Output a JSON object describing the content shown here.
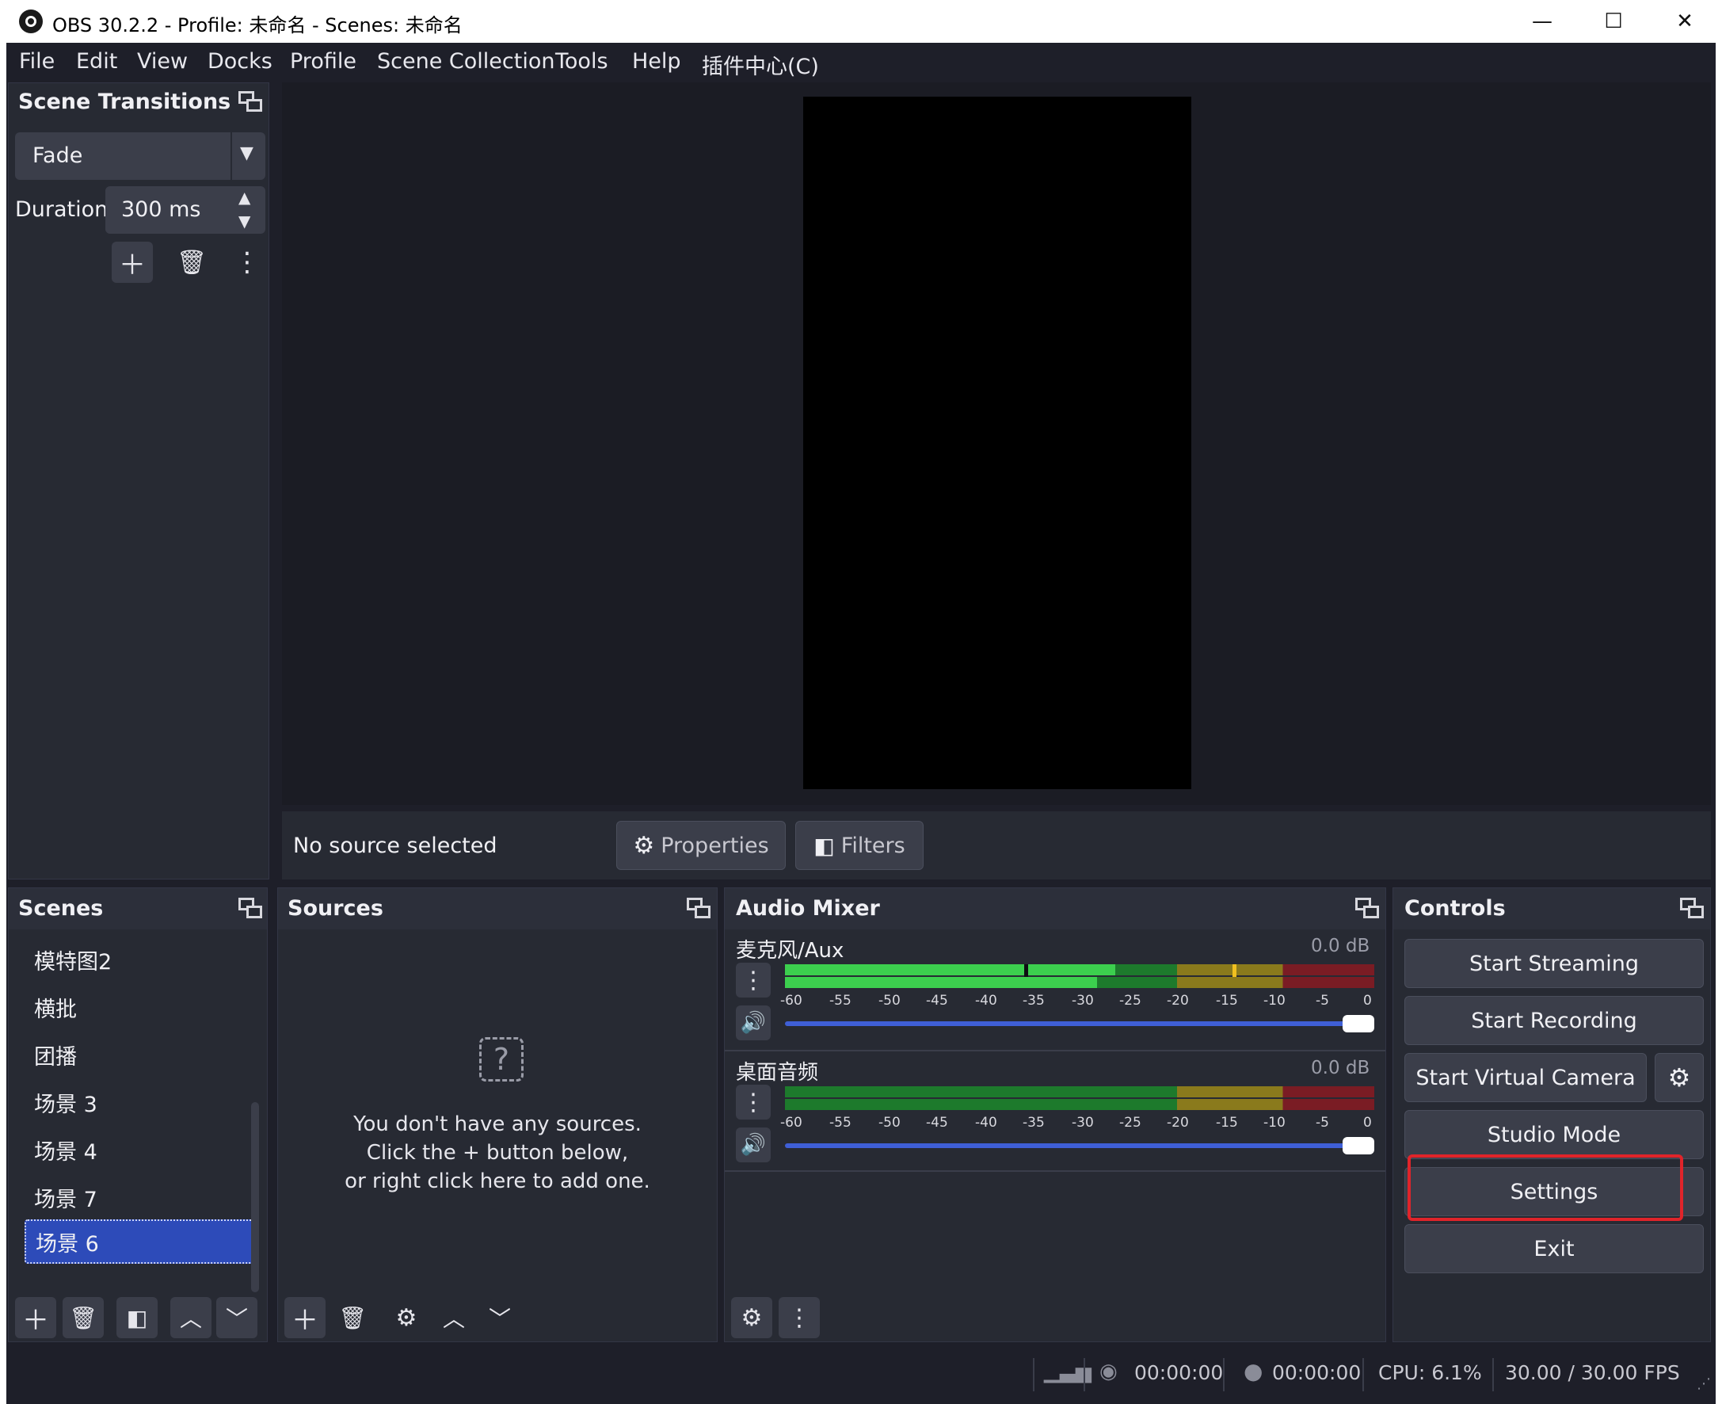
{
  "window": {
    "title": "OBS 30.2.2 - Profile: 未命名 - Scenes: 未命名",
    "minimize_glyph": "—",
    "maximize_glyph": "☐",
    "close_glyph": "✕"
  },
  "menu": [
    "File",
    "Edit",
    "View",
    "Docks",
    "Profile",
    "Scene Collection",
    "Tools",
    "Help",
    "插件中心(C)"
  ],
  "scene_transitions": {
    "title": "Scene Transitions",
    "transition": "Fade",
    "duration_label": "Duration",
    "duration_value": "300 ms"
  },
  "preview": {
    "no_source": "No source selected",
    "properties": "Properties",
    "filters": "Filters"
  },
  "scenes": {
    "title": "Scenes",
    "items": [
      "模特图2",
      "横批",
      "团播",
      "场景 3",
      "场景 4",
      "场景 7",
      "场景 6"
    ],
    "selected": "场景 6"
  },
  "sources": {
    "title": "Sources",
    "empty_line1": "You don't have any sources.",
    "empty_line2": "Click the + button below,",
    "empty_line3": "or right click here to add one."
  },
  "audio_mixer": {
    "title": "Audio Mixer",
    "channels": [
      {
        "name": "麦克风/Aux",
        "level": "0.0 dB"
      },
      {
        "name": "桌面音频",
        "level": "0.0 dB"
      }
    ],
    "scale": [
      "-60",
      "-55",
      "-50",
      "-45",
      "-40",
      "-35",
      "-30",
      "-25",
      "-20",
      "-15",
      "-10",
      "-5",
      "0"
    ]
  },
  "controls": {
    "title": "Controls",
    "start_streaming": "Start Streaming",
    "start_recording": "Start Recording",
    "start_virtual_camera": "Start Virtual Camera",
    "studio_mode": "Studio Mode",
    "settings": "Settings",
    "exit": "Exit"
  },
  "status": {
    "stream_time": "00:00:00",
    "rec_time": "00:00:00",
    "cpu": "CPU: 6.1%",
    "fps": "30.00 / 30.00 FPS"
  },
  "colors": {
    "bg": "#1e1f29",
    "panel": "#272a33",
    "selected": "#2d4bb9",
    "meter_green": "#3ccf4e",
    "meter_dark_green": "#1d7a2c",
    "meter_yellow": "#8a7a1c",
    "meter_red": "#7a1c24",
    "volume_slider": "#3f5fd6",
    "highlight_box": "#e0242a"
  }
}
